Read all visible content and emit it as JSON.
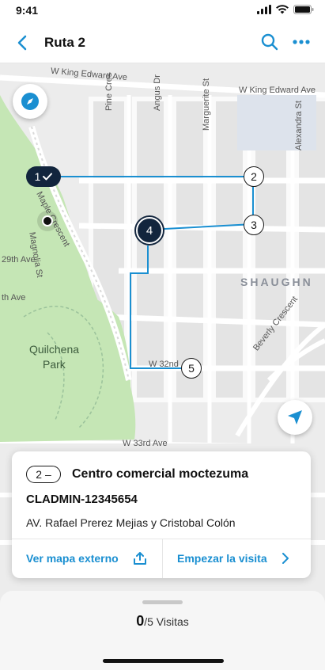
{
  "status_bar": {
    "time": "9:41"
  },
  "nav": {
    "title": "Ruta 2"
  },
  "map": {
    "streets": {
      "king_edward_left": "W King Edward Ave",
      "king_edward_right": "W King Edward Ave",
      "pine_cres": "Pine Cres",
      "angus_dr": "Angus Dr",
      "marguerite_st": "Marguerite St",
      "alexandra_st": "Alexandra St",
      "maple_crescent": "Maple Crescent",
      "magnolia_st": "Magnolia St",
      "ave_29th": "29th Ave",
      "ave_th": "th Ave",
      "shaughn": "SHAUGHN",
      "beverly_crescent": "Beverly Crescent",
      "w_32nd": "W 32nd",
      "w_33rd": "W 33rd Ave",
      "park_line1": "Quilchena",
      "park_line2": "Park"
    },
    "stops": [
      {
        "label": "1",
        "state": "done"
      },
      {
        "label": "2",
        "state": "pending"
      },
      {
        "label": "3",
        "state": "pending"
      },
      {
        "label": "4",
        "state": "current"
      },
      {
        "label": "5",
        "state": "pending"
      }
    ],
    "route_color": "#1a8fd1"
  },
  "card": {
    "badge_number": "2",
    "badge_symbol": "–",
    "title": "Centro comercial moctezuma",
    "code": "CLADMIN-12345654",
    "address": "AV. Rafael Prerez Mejias y Cristobal Colón",
    "external_map_label": "Ver mapa externo",
    "start_visit_label": "Empezar la visita"
  },
  "sheet": {
    "visits_done": "0",
    "visits_total": "/5 Visitas"
  },
  "colors": {
    "accent": "#1a8fd1",
    "marker_dark": "#12253d",
    "park": "#c5e6b5"
  }
}
